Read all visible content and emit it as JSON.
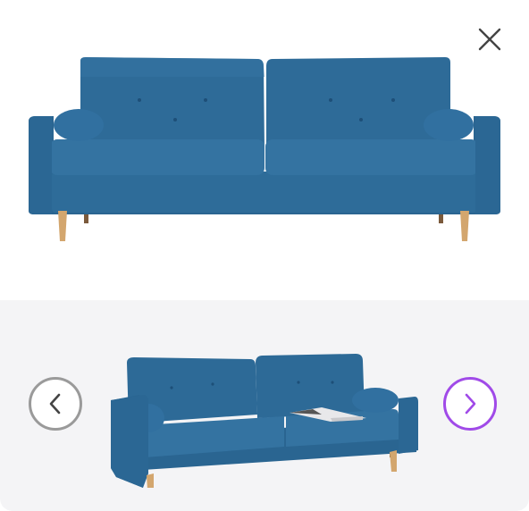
{
  "viewer": {
    "close_icon": "close-icon",
    "main_image_alt": "sofa",
    "prev_icon": "chevron-left-icon",
    "next_icon": "chevron-right-icon"
  },
  "colors": {
    "sofa_blue": "#2d6a97",
    "sofa_dark": "#1f5580",
    "leg_wood": "#d3a66e",
    "carousel_bg": "#f4f4f6",
    "prev_border": "#9a9a9a",
    "next_border": "#a04ae8"
  }
}
